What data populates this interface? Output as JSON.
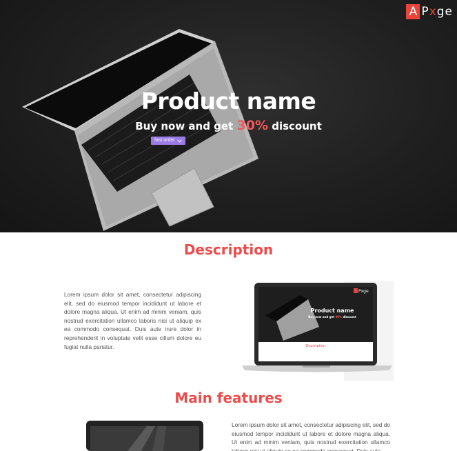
{
  "logo": {
    "first": "A",
    "rest_before": "P",
    "x": "x",
    "rest_after": "ge"
  },
  "hero": {
    "title": "Product name",
    "subtitle_before": "Buy now and get ",
    "discount": "30%",
    "subtitle_after": " discount",
    "fast_order_label": "fast order"
  },
  "description": {
    "title": "Description",
    "text": "Lorem ipsum dolor sit amet, consectetur adipiscing elit, sed do eiusmod tempor incididunt ut labore et dolore magna aliqua. Ut enim ad minim veniam, quis nostrud exercitation ullamco laboris nisi ut aliquip ex ea commodo consequat. Duis aute irure dolor in reprehenderit in voluptate velit esse cillum dolore eu fugiat nulla pariatur.",
    "mockup": {
      "title": "Product name",
      "subtitle_before": "Buy now and get ",
      "discount": "30%",
      "subtitle_after": " discount",
      "section": "Description"
    }
  },
  "features": {
    "title": "Main features",
    "text": "Lorem ipsum dolor sit amet, consectetur adipiscing elit, sed do eiusmod tempor incididunt ut labore et dolore magna aliqua. Ut enim ad minim veniam, quis nostrud exercitation ullamco laboris nisi ut aliquip ex ea commodo consequat. Duis aute"
  },
  "colors": {
    "accent": "#ee4a4a",
    "button": "#9b7be6",
    "hero_bg": "#1f1f1f"
  }
}
